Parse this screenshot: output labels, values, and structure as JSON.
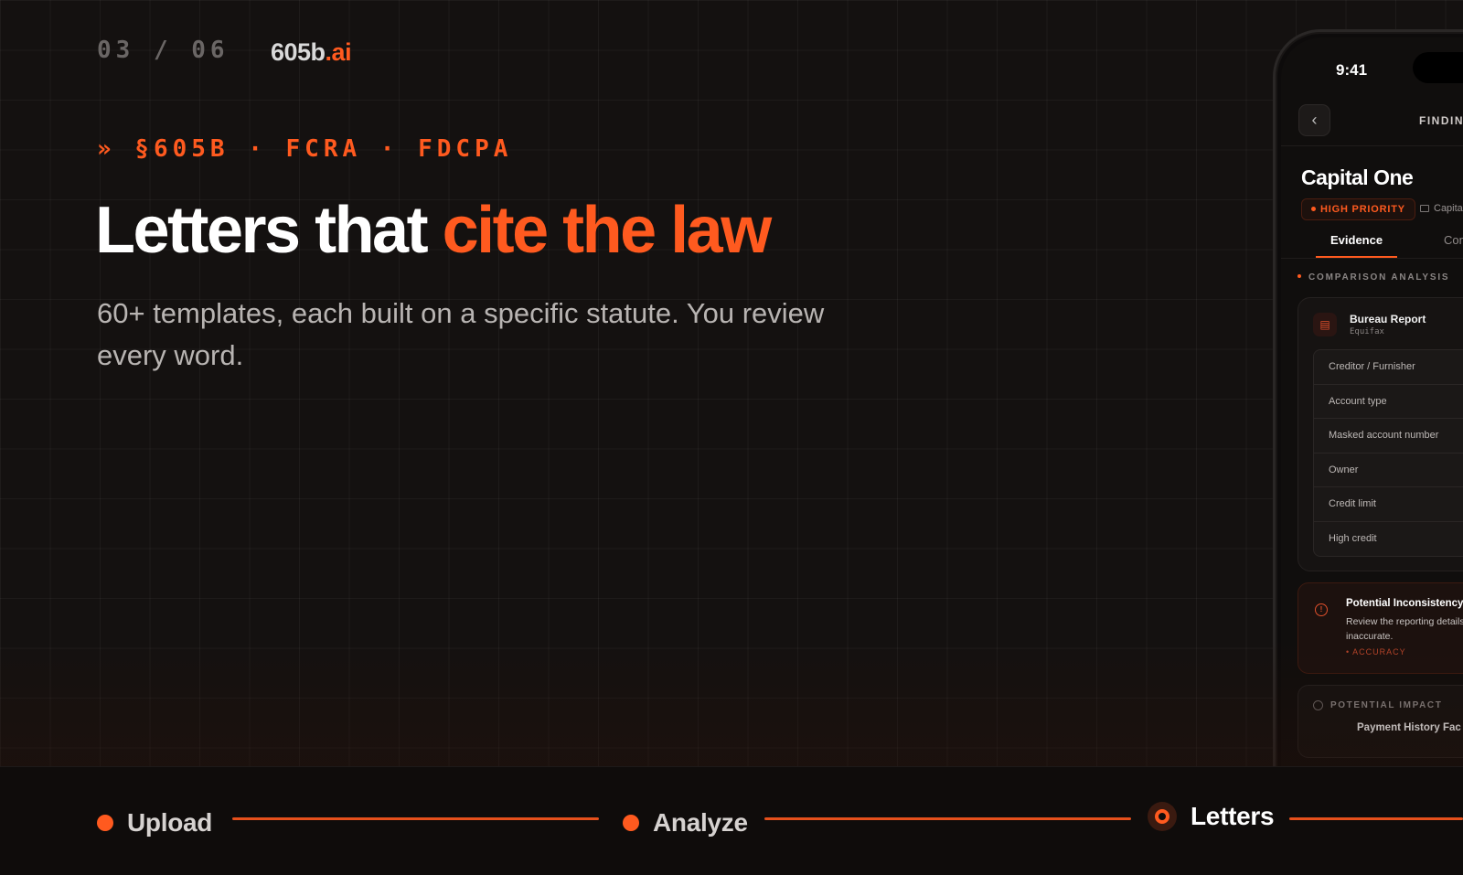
{
  "header": {
    "slide_counter": "03 / 06",
    "brand_main": "605b",
    "brand_suffix": ".ai"
  },
  "hero": {
    "eyebrow": "» §605B · FCRA · FDCPA",
    "headline_white": "Letters that ",
    "headline_accent": "cite the law",
    "subtitle": "60+ templates, each built on a specific statute. You review every word."
  },
  "phone": {
    "time": "9:41",
    "back_icon": "chevron-left-icon",
    "header_title": "FINDING",
    "company": "Capital One",
    "priority_badge": "HIGH PRIORITY",
    "meta_label": "Capita",
    "tabs": [
      "Evidence",
      "Con"
    ],
    "section_title": "COMPARISON ANALYSIS",
    "report": {
      "title": "Bureau Report",
      "bureau": "Equifax",
      "rows": [
        "Creditor / Furnisher",
        "Account type",
        "Masked account number",
        "Owner",
        "Credit limit",
        "High credit"
      ]
    },
    "alert": {
      "title": "Potential Inconsistency",
      "body": "Review the reporting details this item is inaccurate.",
      "tag": "• ACCURACY"
    },
    "impact": {
      "title": "POTENTIAL IMPACT",
      "item": "Payment History Fac"
    }
  },
  "progress": {
    "steps": [
      {
        "label": "Upload",
        "state": "done"
      },
      {
        "label": "Analyze",
        "state": "done"
      },
      {
        "label": "Letters",
        "state": "current"
      }
    ]
  },
  "colors": {
    "accent": "#ff5a1f",
    "background": "#141110"
  }
}
